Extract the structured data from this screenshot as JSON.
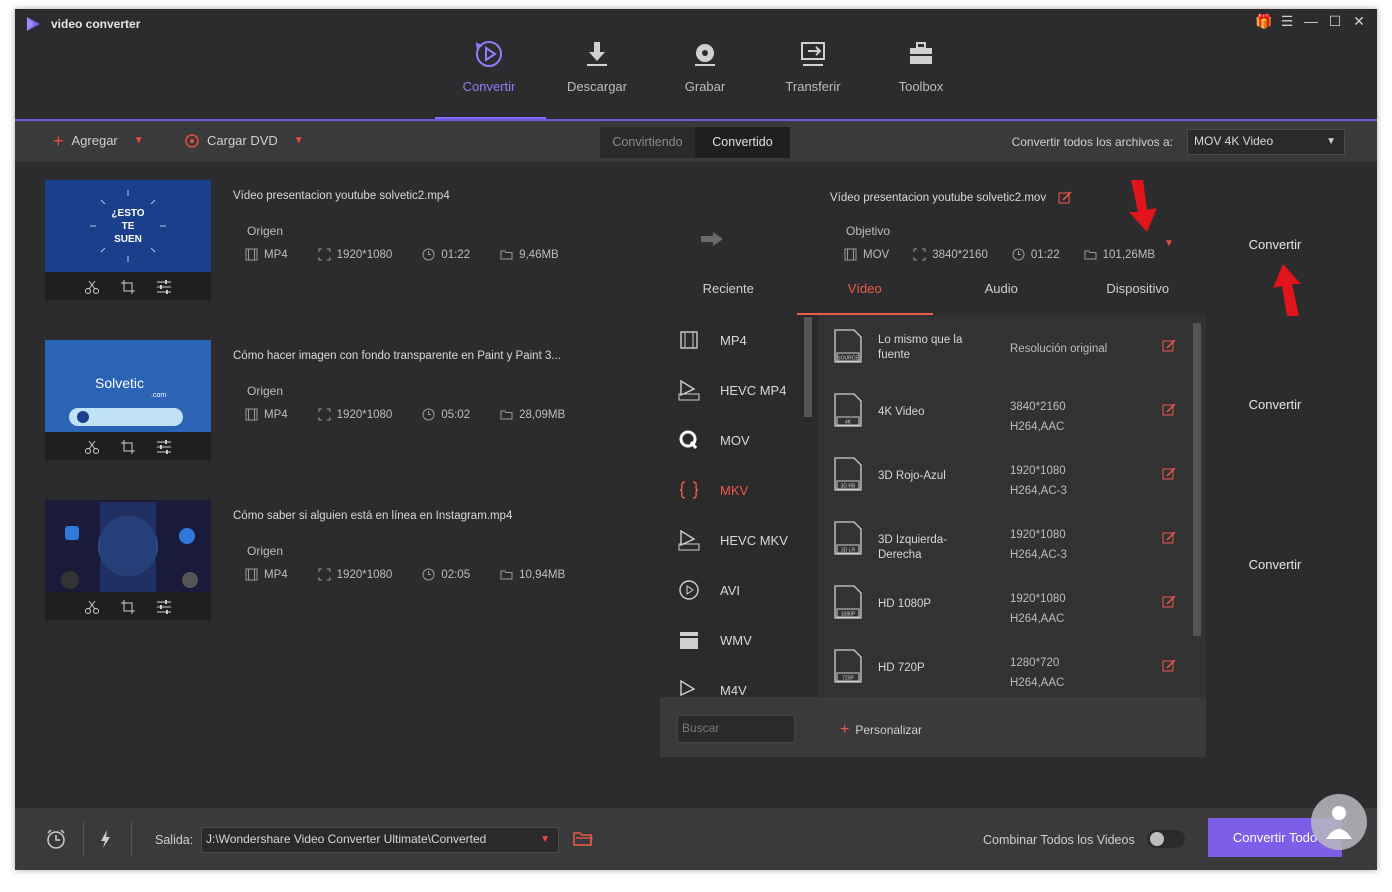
{
  "app": {
    "title": "video converter"
  },
  "nav": [
    {
      "label": "Convertir",
      "icon": "convert-icon",
      "active": true
    },
    {
      "label": "Descargar",
      "icon": "download-icon"
    },
    {
      "label": "Grabar",
      "icon": "burn-disc-icon"
    },
    {
      "label": "Transferir",
      "icon": "transfer-icon"
    },
    {
      "label": "Toolbox",
      "icon": "toolbox-icon"
    }
  ],
  "toolbar": {
    "add_label": "Agregar",
    "load_dvd_label": "Cargar DVD",
    "seg_converting": "Convirtiendo",
    "seg_converted": "Convertido",
    "convert_all_to_label": "Convertir todos los archivos a:",
    "convert_all_to_value": "MOV 4K Video"
  },
  "files": [
    {
      "name": "Vídeo presentacion youtube solvetic2.mp4",
      "origin_label": "Origen",
      "format": "MP4",
      "resolution": "1920*1080",
      "duration": "01:22",
      "size": "9,46MB",
      "thumb_text": [
        "¿ESTO",
        "TE",
        "SUEN"
      ],
      "target_name": "Vídeo presentacion youtube solvetic2.mov",
      "target_label": "Objetivo",
      "target_format": "MOV",
      "target_resolution": "3840*2160",
      "target_duration": "01:22",
      "target_size": "101,26MB",
      "convert_label": "Convertir"
    },
    {
      "name": "Cómo hacer imagen con fondo transparente en Paint y Paint 3...",
      "origin_label": "Origen",
      "format": "MP4",
      "resolution": "1920*1080",
      "duration": "05:02",
      "size": "28,09MB",
      "thumb_text": [
        "Solvetic",
        ".com"
      ],
      "convert_label": "Convertir"
    },
    {
      "name": "Cómo saber si alguien está en línea en Instagram.mp4",
      "origin_label": "Origen",
      "format": "MP4",
      "resolution": "1920*1080",
      "duration": "02:05",
      "size": "10,94MB",
      "convert_label": "Convertir"
    }
  ],
  "panel": {
    "tabs": [
      "Reciente",
      "Vídeo",
      "Audio",
      "Dispositivo"
    ],
    "active_tab": 1,
    "formats": [
      "MP4",
      "HEVC MP4",
      "MOV",
      "MKV",
      "HEVC MKV",
      "AVI",
      "WMV",
      "M4V"
    ],
    "active_format": 3,
    "resolutions": [
      {
        "name": "Lo mismo que la fuente",
        "badge": "SOURCE",
        "line1": "Resolución original",
        "line2": ""
      },
      {
        "name": "4K Video",
        "badge": "4K",
        "line1": "3840*2160",
        "line2": "H264,AAC"
      },
      {
        "name": "3D Rojo-Azul",
        "badge": "3D RB",
        "line1": "1920*1080",
        "line2": "H264,AC-3"
      },
      {
        "name": "3D Izquierda-Derecha",
        "badge": "3D LR",
        "line1": "1920*1080",
        "line2": "H264,AC-3"
      },
      {
        "name": "HD 1080P",
        "badge": "1080P",
        "line1": "1920*1080",
        "line2": "H264,AAC"
      },
      {
        "name": "HD 720P",
        "badge": "720P",
        "line1": "1280*720",
        "line2": "H264,AAC"
      }
    ],
    "search_placeholder": "Buscar",
    "customize_label": "Personalizar"
  },
  "bottom": {
    "output_label": "Salida:",
    "output_path": "J:\\Wondershare Video Converter Ultimate\\Converted",
    "merge_label": "Combinar Todos los Videos",
    "merge_enabled": false,
    "convert_all_label": "Convertir Todo"
  },
  "colors": {
    "accent": "#7d6bff",
    "highlight": "#ef5a48",
    "bg": "#2c2c2e"
  }
}
